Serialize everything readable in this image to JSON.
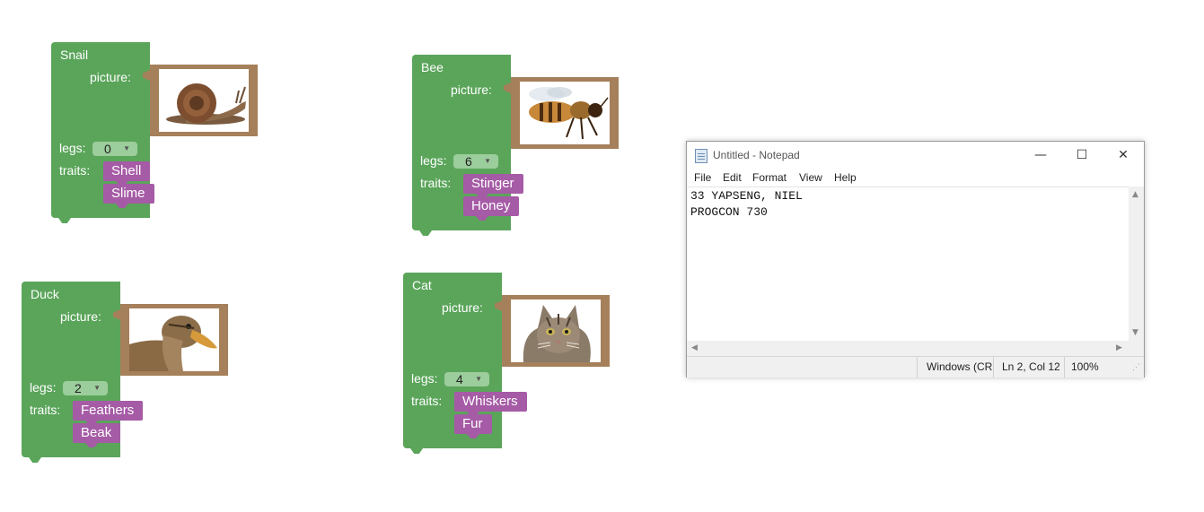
{
  "blocks": [
    {
      "id": "snail",
      "title": "Snail",
      "picture_label": "picture:",
      "legs_label": "legs:",
      "legs_value": "0",
      "traits_label": "traits:",
      "traits": [
        "Shell",
        "Slime"
      ],
      "image_icon": "snail-picture"
    },
    {
      "id": "bee",
      "title": "Bee",
      "picture_label": "picture:",
      "legs_label": "legs:",
      "legs_value": "6",
      "traits_label": "traits:",
      "traits": [
        "Stinger",
        "Honey"
      ],
      "image_icon": "bee-picture"
    },
    {
      "id": "duck",
      "title": "Duck",
      "picture_label": "picture:",
      "legs_label": "legs:",
      "legs_value": "2",
      "traits_label": "traits:",
      "traits": [
        "Feathers",
        "Beak"
      ],
      "image_icon": "duck-picture"
    },
    {
      "id": "cat",
      "title": "Cat",
      "picture_label": "picture:",
      "legs_label": "legs:",
      "legs_value": "4",
      "traits_label": "traits:",
      "traits": [
        "Whiskers",
        "Fur"
      ],
      "image_icon": "cat-picture"
    }
  ],
  "colors": {
    "block_green": "#5ba55b",
    "dropdown_green": "#9ccd9c",
    "trait_purple": "#a55ba5",
    "picture_frame": "#a5805a"
  },
  "notepad": {
    "title": "Untitled - Notepad",
    "controls": {
      "minimize": "—",
      "maximize": "☐",
      "close": "✕"
    },
    "menu": [
      "File",
      "Edit",
      "Format",
      "View",
      "Help"
    ],
    "lines": [
      "33 YAPSENG, NIEL",
      "PROGCON 730"
    ],
    "status": {
      "encoding": "Windows (CR",
      "position": "Ln 2, Col 12",
      "zoom": "100%"
    }
  }
}
